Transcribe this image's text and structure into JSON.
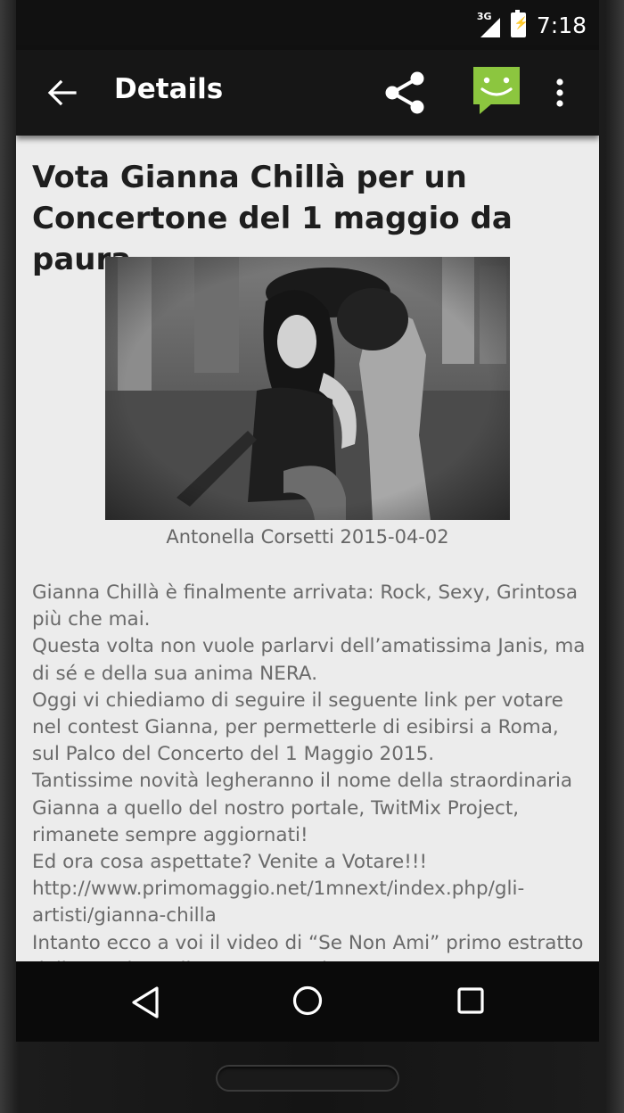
{
  "status_bar": {
    "network_label": "3G",
    "time": "7:18"
  },
  "app_bar": {
    "title": "Details"
  },
  "article": {
    "headline": "Vota Gianna Chillà per un Concertone del 1 maggio da paura",
    "image_caption": "Antonella Corsetti 2015-04-02",
    "paragraphs": [
      "Gianna Chillà è finalmente arrivata: Rock, Sexy, Grintosa più che mai.",
      "Questa volta non vuole parlarvi dell’amatissima Janis, ma di sé e della sua anima NERA.",
      "Oggi vi chiediamo di seguire il seguente link per votare nel contest Gianna, per permetterle di esibirsi a Roma, sul Palco del Concerto del 1 Maggio 2015.",
      "Tantissime novità legheranno il nome della straordinaria Gianna a quello del nostro portale, TwitMix Project, rimanete sempre aggiornati!",
      "Ed ora cosa aspettate? Venite a Votare!!!",
      "http://www.primomaggio.net/1mnext/index.php/gli-artisti/gianna-chilla",
      "Intanto ecco a voi il video di “Se Non Ami” primo estratto dall’omonimo album. Nuovo! Il nostro"
    ]
  },
  "icons": {
    "back": "arrow-back-icon",
    "share": "share-icon",
    "sms": "sms-smiley-icon",
    "more": "overflow-menu-icon",
    "nav_back": "nav-back-triangle-icon",
    "nav_home": "nav-home-circle-icon",
    "nav_recents": "nav-recents-square-icon"
  },
  "colors": {
    "app_bar": "#161616",
    "sms_icon": "#8cc63f",
    "content_bg": "#ececec"
  }
}
